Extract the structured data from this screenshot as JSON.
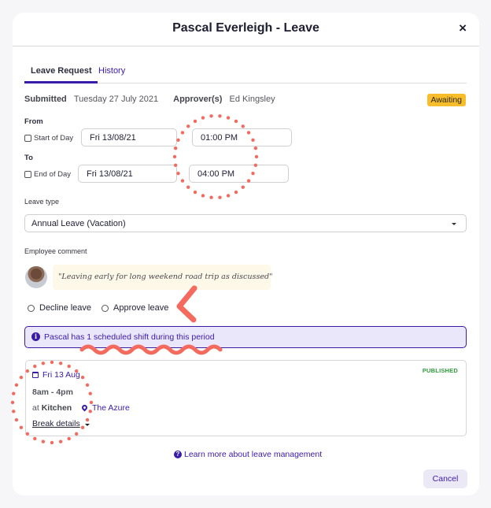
{
  "modal": {
    "title": "Pascal Everleigh - Leave",
    "close_icon": "×"
  },
  "tabs": [
    {
      "label": "Leave Request",
      "active": true
    },
    {
      "label": "History",
      "active": false
    }
  ],
  "meta": {
    "submitted_label": "Submitted",
    "submitted_value": "Tuesday 27 July 2021",
    "approver_label": "Approver(s)",
    "approver_value": "Ed Kingsley",
    "status": "Awaiting"
  },
  "from": {
    "label": "From",
    "checkbox_label": "Start of Day",
    "date": "Fri 13/08/21",
    "time": "01:00 PM"
  },
  "to": {
    "label": "To",
    "checkbox_label": "End of Day",
    "date": "Fri 13/08/21",
    "time": "04:00 PM"
  },
  "leave_type": {
    "label": "Leave type",
    "value": "Annual Leave (Vacation)"
  },
  "comment": {
    "label": "Employee comment",
    "text": "\"Leaving early for long weekend road trip as discussed\""
  },
  "decision": {
    "decline_label": "Decline leave",
    "approve_label": "Approve leave"
  },
  "info": {
    "icon": "i",
    "text": "Pascal has 1 scheduled shift during this period"
  },
  "shift": {
    "date": "Fri 13 Aug",
    "time": "8am - 4pm",
    "at_prefix": "at",
    "area": "Kitchen",
    "venue": "The Azure",
    "break_label": "Break details",
    "status": "PUBLISHED"
  },
  "footer": {
    "help_icon": "?",
    "learn_more": "Learn more about leave management",
    "cancel_label": "Cancel"
  },
  "colors": {
    "accent": "#3a1aa8",
    "status_awaiting": "#f7bd2a",
    "published": "#2f9a39",
    "annotation": "#f56a5e"
  }
}
